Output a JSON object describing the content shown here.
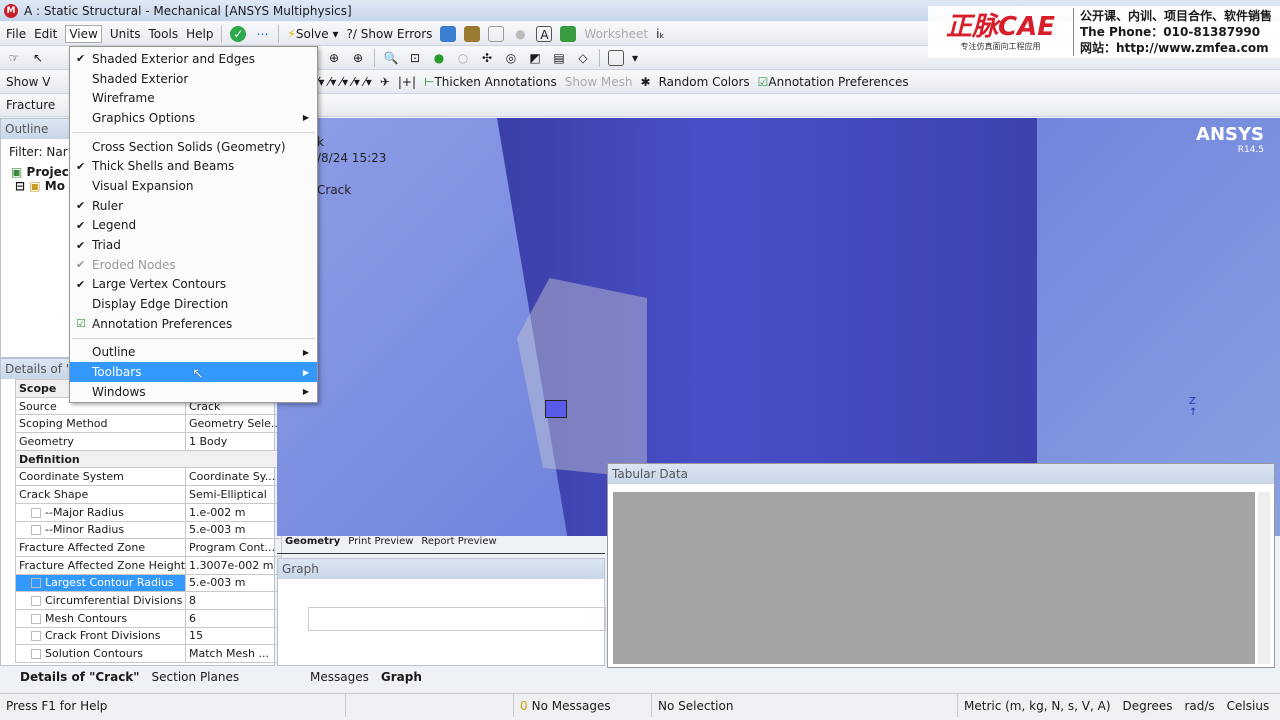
{
  "title": "A : Static Structural - Mechanical [ANSYS Multiphysics]",
  "menubar": [
    "File",
    "Edit",
    "View",
    "Units",
    "Tools",
    "Help"
  ],
  "toolbar1": {
    "solve": "Solve",
    "show_errors": "?/ Show Errors",
    "worksheet": "Worksheet"
  },
  "toolbar3": {
    "show_vertices": "Show V",
    "thicken": "Thicken Annotations",
    "show_mesh": "Show Mesh",
    "random_colors": "Random Colors",
    "annotation_prefs": "Annotation Preferences"
  },
  "toolbar4": {
    "fracture": "Fracture"
  },
  "brand": {
    "logo": "正脉CAE",
    "tagline": "专注仿真面向工程应用",
    "line1": "公开课、内训、项目合作、软件销售",
    "line2": "The Phone：010-81387990",
    "line3": "网站：http://www.zmfea.com"
  },
  "outline": {
    "title": "Outline",
    "filter": "Filter:",
    "filter_value": "Nar",
    "project": "Project",
    "model": "Mo"
  },
  "view_menu": {
    "items": [
      {
        "label": "Shaded Exterior and Edges",
        "checked": true
      },
      {
        "label": "Shaded Exterior"
      },
      {
        "label": "Wireframe"
      },
      {
        "label": "Graphics Options",
        "submenu": true
      },
      {
        "sep": true
      },
      {
        "label": "Cross Section Solids (Geometry)"
      },
      {
        "label": "Thick Shells and Beams",
        "checked": true
      },
      {
        "label": "Visual Expansion"
      },
      {
        "label": "Ruler",
        "checked": true
      },
      {
        "label": "Legend",
        "checked": true
      },
      {
        "label": "Triad",
        "checked": true
      },
      {
        "label": "Eroded Nodes",
        "checked": true,
        "disabled": true
      },
      {
        "label": "Large Vertex Contours",
        "checked": true
      },
      {
        "label": "Display Edge Direction"
      },
      {
        "label": "Annotation Preferences",
        "icon": true
      },
      {
        "sep": true
      },
      {
        "label": "Outline",
        "submenu": true
      },
      {
        "label": "Toolbars",
        "submenu": true,
        "highlighted": true
      },
      {
        "label": "Windows",
        "submenu": true
      }
    ]
  },
  "details": {
    "title": "Details of \"C",
    "rows": [
      {
        "group": "Scope"
      },
      {
        "k": "Source",
        "v": "Crack"
      },
      {
        "k": "Scoping Method",
        "v": "Geometry Sele..."
      },
      {
        "k": "Geometry",
        "v": "1 Body"
      },
      {
        "group": "Definition"
      },
      {
        "k": "Coordinate System",
        "v": "Coordinate Sy..."
      },
      {
        "k": "Crack Shape",
        "v": "Semi-Elliptical"
      },
      {
        "k": "--Major Radius",
        "v": "1.e-002 m",
        "cb": true
      },
      {
        "k": "--Minor Radius",
        "v": "5.e-003 m",
        "cb": true
      },
      {
        "k": "Fracture Affected Zone",
        "v": "Program Cont..."
      },
      {
        "k": "Fracture Affected Zone Height",
        "v": "1.3007e-002 m"
      },
      {
        "k": "Largest Contour Radius",
        "v": "5.e-003 m",
        "cb": true,
        "selected": true
      },
      {
        "k": "Circumferential Divisions",
        "v": "8",
        "cb": true
      },
      {
        "k": "Mesh Contours",
        "v": "6",
        "cb": true
      },
      {
        "k": "Crack Front Divisions",
        "v": "15",
        "cb": true
      },
      {
        "k": "Solution Contours",
        "v": "Match Mesh ...",
        "cb": true
      }
    ],
    "tabs": [
      "Details of \"Crack\"",
      "Section Planes"
    ]
  },
  "viewport": {
    "line1": "k",
    "date": "/8/24 15:23",
    "line3": "Crack",
    "ansys": "ANSYS",
    "version": "R14.5",
    "tabs": [
      "Geometry",
      "Print Preview",
      "Report Preview"
    ]
  },
  "tabular": {
    "title": "Tabular Data"
  },
  "graph": {
    "title": "Graph",
    "tabs": [
      "Messages",
      "Graph"
    ]
  },
  "status": {
    "help": "Press F1 for Help",
    "messages_count": "0",
    "messages": "No Messages",
    "selection": "No Selection",
    "units": "Metric (m, kg, N, s, V, A)",
    "angle": "Degrees",
    "rot": "rad/s",
    "temp": "Celsius"
  },
  "colors": {
    "accent": "#3399ff",
    "geometry": "#4a4fc8",
    "background": "#7f92e0"
  }
}
